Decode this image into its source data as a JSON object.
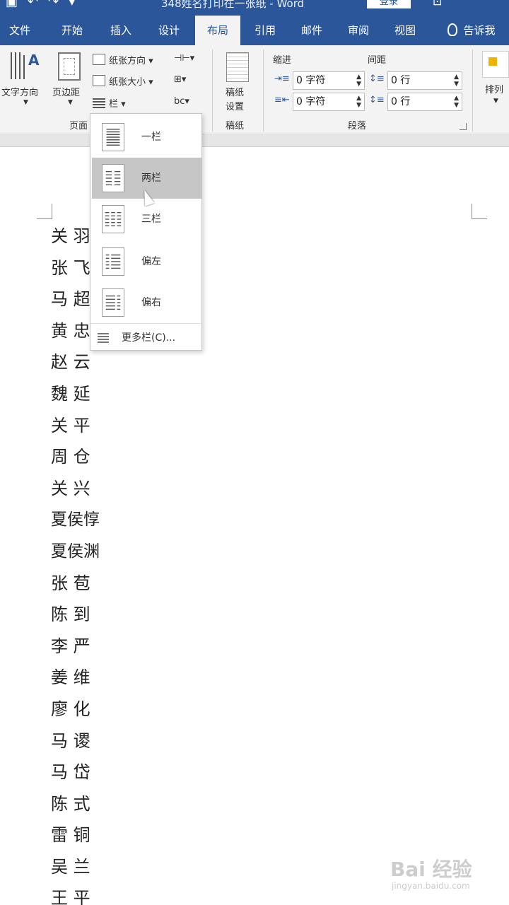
{
  "window": {
    "doc_title": "348姓名打印在一张纸 - Word",
    "login_label": "登录",
    "qat_icons": [
      "save-icon",
      "undo-icon",
      "redo-icon",
      "customize-icon"
    ]
  },
  "tabs": [
    {
      "label": "文件"
    },
    {
      "label": "开始"
    },
    {
      "label": "插入"
    },
    {
      "label": "设计"
    },
    {
      "label": "布局",
      "active": true
    },
    {
      "label": "引用"
    },
    {
      "label": "邮件"
    },
    {
      "label": "审阅"
    },
    {
      "label": "视图"
    },
    {
      "label": "告诉我"
    }
  ],
  "ribbon": {
    "page_setup": {
      "text_direction": "文字方向",
      "margins": "页边距",
      "orientation": "纸张方向",
      "size": "纸张大小",
      "columns": "栏",
      "group_label": "页面"
    },
    "manuscript": {
      "setup_line1": "稿纸",
      "setup_line2": "设置",
      "group_label": "稿纸"
    },
    "paragraph": {
      "indent_header": "缩进",
      "spacing_header": "间距",
      "indent_left": "0 字符",
      "indent_right": "0 字符",
      "spacing_before": "0 行",
      "spacing_after": "0 行",
      "group_label": "段落"
    },
    "arrange": {
      "label": "排列"
    }
  },
  "columns_menu": {
    "items": [
      {
        "label": "一栏"
      },
      {
        "label": "两栏",
        "selected": true
      },
      {
        "label": "三栏"
      },
      {
        "label": "偏左"
      },
      {
        "label": "偏右"
      }
    ],
    "more": "更多栏(C)..."
  },
  "document": {
    "names": [
      "关 羽",
      "张 飞",
      "马 超",
      "黄 忠",
      "赵 云",
      "魏 延",
      "关 平",
      "周 仓",
      "关 兴",
      "夏侯惇",
      "夏侯渊",
      "张 苞",
      "陈 到",
      "李 严",
      "姜 维",
      "廖 化",
      "马 谡",
      "马 岱",
      "陈 式",
      "雷 铜",
      "吴 兰",
      "王 平"
    ]
  },
  "watermark": {
    "main": "Bai 经验",
    "sub": "jingyan.baidu.com"
  }
}
